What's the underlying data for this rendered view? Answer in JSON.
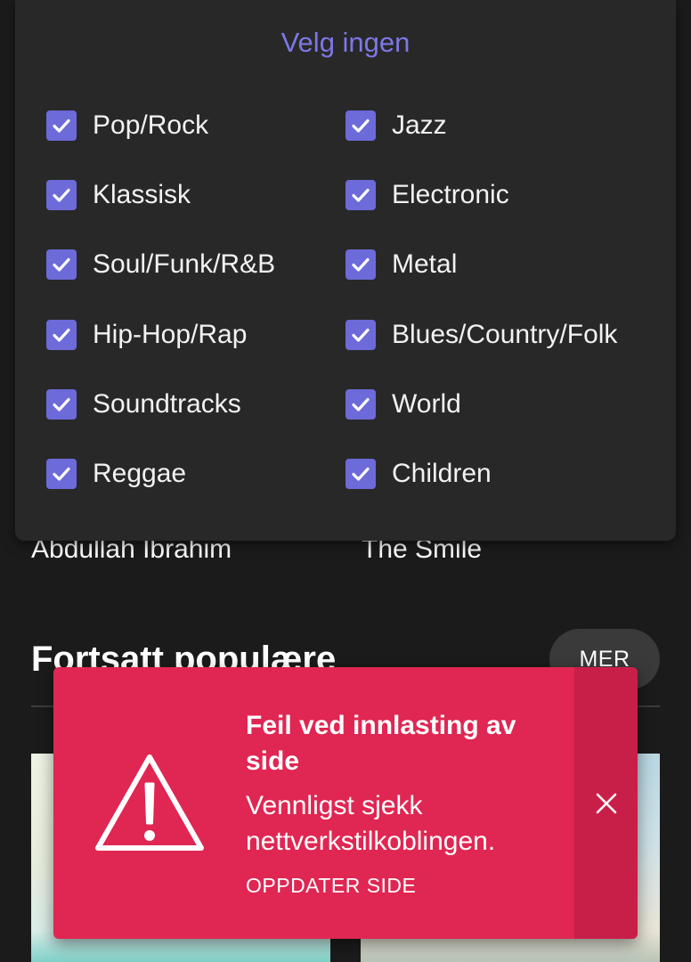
{
  "filter": {
    "select_none_label": "Velg ingen",
    "genres": [
      {
        "label": "Pop/Rock",
        "checked": true
      },
      {
        "label": "Jazz",
        "checked": true
      },
      {
        "label": "Klassisk",
        "checked": true
      },
      {
        "label": "Electronic",
        "checked": true
      },
      {
        "label": "Soul/Funk/R&B",
        "checked": true
      },
      {
        "label": "Metal",
        "checked": true
      },
      {
        "label": "Hip-Hop/Rap",
        "checked": true
      },
      {
        "label": "Blues/Country/Folk",
        "checked": true
      },
      {
        "label": "Soundtracks",
        "checked": true
      },
      {
        "label": "World",
        "checked": true
      },
      {
        "label": "Reggae",
        "checked": true
      },
      {
        "label": "Children",
        "checked": true
      }
    ],
    "accent_color": "#6d6ad9"
  },
  "artists": [
    "Abdullah Ibrahim",
    "The Smile"
  ],
  "section": {
    "title": "Fortsatt populære",
    "more_label": "MER"
  },
  "toast": {
    "title": "Feil ved innlasting av side",
    "message": "Vennligst sjekk nettverkstilkoblingen.",
    "action_label": "OPPDATER SIDE",
    "icon": "warning-icon",
    "close_icon": "close-icon",
    "background_color": "#e02652"
  }
}
